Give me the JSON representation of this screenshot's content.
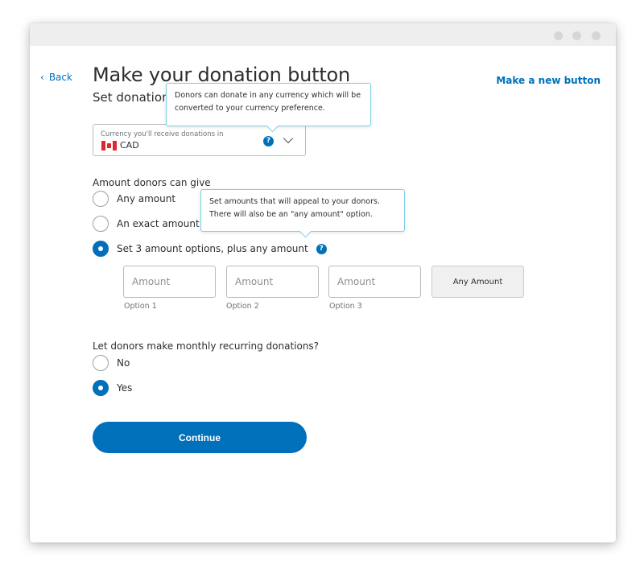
{
  "header": {
    "back_label": "Back",
    "title": "Make your donation button",
    "subtitle": "Set donation",
    "new_button_label": "Make a new button"
  },
  "tooltips": {
    "currency": "Donors can donate in any currency which will be converted to your currency preference.",
    "amounts": "Set amounts that will appeal to your donors. There will also be an \"any amount\" option."
  },
  "currency": {
    "label": "Currency you'll receive donations in",
    "value": "CAD",
    "help_icon": "?"
  },
  "amount_section": {
    "label": "Amount donors can give",
    "options": [
      {
        "label": "Any amount",
        "checked": false
      },
      {
        "label": "An exact amount",
        "checked": false
      },
      {
        "label": "Set 3 amount options, plus any amount",
        "checked": true
      }
    ],
    "help_icon": "?",
    "inputs": [
      {
        "placeholder": "Amount",
        "caption": "Option 1"
      },
      {
        "placeholder": "Amount",
        "caption": "Option 2"
      },
      {
        "placeholder": "Amount",
        "caption": "Option 3"
      }
    ],
    "any_amount_button": "Any Amount"
  },
  "recurring_section": {
    "label": "Let donors make monthly recurring donations?",
    "options": [
      {
        "label": "No",
        "checked": false
      },
      {
        "label": "Yes",
        "checked": true
      }
    ]
  },
  "continue_label": "Continue",
  "colors": {
    "accent": "#0070ba",
    "tooltip_border": "#7ed0e7",
    "titlebar": "#eeeeee"
  }
}
